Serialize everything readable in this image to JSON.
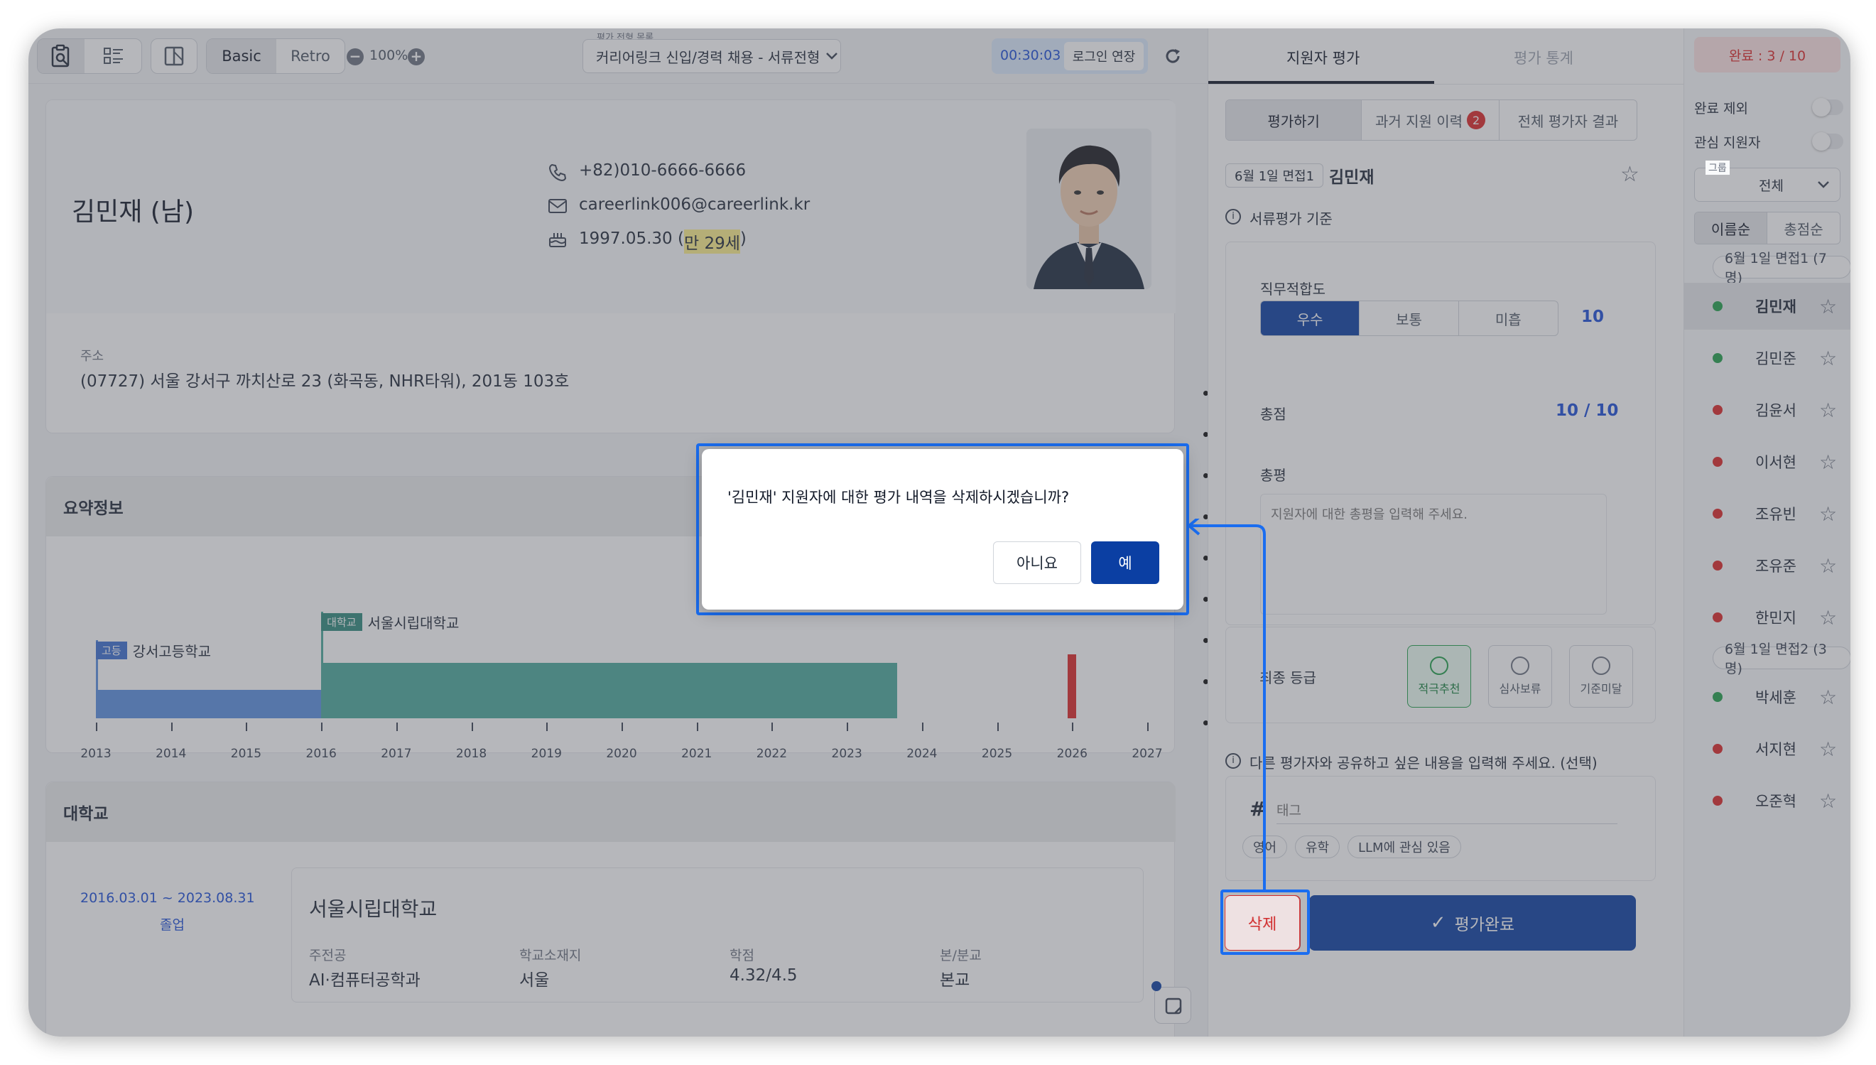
{
  "toolbar": {
    "mode_basic": "Basic",
    "mode_retro": "Retro",
    "zoom": "100%",
    "process_caption": "평가 전형 목록",
    "process_value": "커리어링크 신입/경력 채용 - 서류전형",
    "timer": "00:30:03",
    "login_extend": "로그인 연장"
  },
  "profile": {
    "name": "김민재 (남)",
    "phone": "+82)010-6666-6666",
    "email": "careerlink006@careerlink.kr",
    "birth": "1997.05.30 (",
    "age": "만 29세",
    ")": ")",
    "address_label": "주소",
    "address": "(07727) 서울 강서구 까치산로 23 (화곡동, NHR타워), 201동 103호"
  },
  "summary": {
    "title": "요약정보",
    "high_badge": "고등",
    "high_name": "강서고등학교",
    "univ_badge": "대학교",
    "univ_name": "서울시립대학교",
    "years": [
      "2013",
      "2014",
      "2015",
      "2016",
      "2017",
      "2018",
      "2019",
      "2020",
      "2021",
      "2022",
      "2023",
      "2024",
      "2025",
      "2026",
      "2027"
    ]
  },
  "university": {
    "title": "대학교",
    "period": "2016.03.01 ~ 2023.08.31",
    "status": "졸업",
    "school": "서울시립대학교",
    "major_label": "주전공",
    "major": "AI·컴퓨터공학과",
    "location_label": "학교소재지",
    "location": "서울",
    "gpa_label": "학점",
    "gpa": "4.32/4.5",
    "campus_label": "본/분교",
    "campus": "본교"
  },
  "eval": {
    "tab_eval": "지원자 평가",
    "tab_stats": "평가 통계",
    "sub_eval": "평가하기",
    "sub_history": "과거 지원 이력",
    "history_count": "2",
    "sub_all": "전체 평가자 결과",
    "group_tag": "6월 1일 면접1",
    "applicant": "김민재",
    "criteria": "서류평가 기준",
    "fit_label": "직무적합도",
    "fit_options": [
      "우수",
      "보통",
      "미흡"
    ],
    "fit_score": "10",
    "total_label": "총점",
    "total_score": "10 / 10",
    "review_label": "총평",
    "review_placeholder": "지원자에 대한 총평을 입력해 주세요.",
    "final_label": "최종 등급",
    "grades": [
      "적극추천",
      "심사보류",
      "기준미달"
    ],
    "share_note": "다른 평가자와 공유하고 싶은 내용을 입력해 주세요. (선택)",
    "tag_placeholder": "태그",
    "tags": [
      "영어",
      "유학",
      "LLM에 관심 있음"
    ],
    "delete_label": "삭제",
    "complete_label": "평가완료"
  },
  "list": {
    "done": "완료 : 3 / 10",
    "exclude_done": "완료 제외",
    "interest": "관심 지원자",
    "group_caption": "그룹",
    "group_value": "전체",
    "sort_name": "이름순",
    "sort_score": "총점순",
    "group1": "6월 1일 면접1 (7명)",
    "group2": "6월 1일 면접2 (3명)",
    "group1_rows": [
      {
        "name": "김민재",
        "color": "#22a04b"
      },
      {
        "name": "김민준",
        "color": "#22a04b"
      },
      {
        "name": "김윤서",
        "color": "#dc2626"
      },
      {
        "name": "이서현",
        "color": "#dc2626"
      },
      {
        "name": "조유빈",
        "color": "#dc2626"
      },
      {
        "name": "조유준",
        "color": "#dc2626"
      },
      {
        "name": "한민지",
        "color": "#dc2626"
      }
    ],
    "group2_rows": [
      {
        "name": "박세훈",
        "color": "#22a04b"
      },
      {
        "name": "서지현",
        "color": "#dc2626"
      },
      {
        "name": "오준혁",
        "color": "#dc2626"
      }
    ]
  },
  "dialog": {
    "message": "'김민재' 지원자에 대한 평가 내역을 삭제하시겠습니까?",
    "no": "아니요",
    "yes": "예"
  },
  "colors": {
    "primary": "#0b3fa3",
    "accent": "#1a6df0",
    "danger": "#dc2626",
    "teal": "#4aa99b",
    "blue_bar": "#5b8fe0"
  }
}
